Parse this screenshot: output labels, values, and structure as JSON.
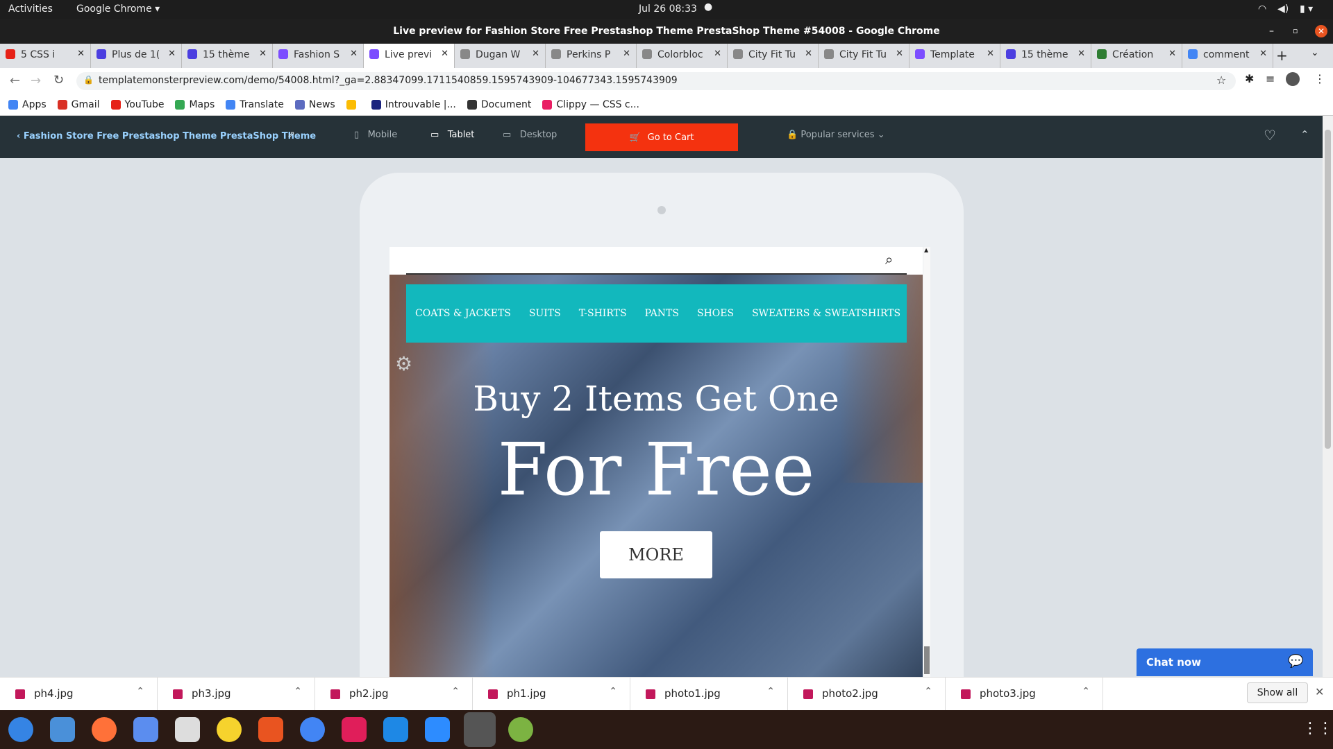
{
  "system_bar": {
    "activities": "Activities",
    "app_menu": "Google Chrome",
    "datetime": "Jul 26  08:33"
  },
  "window_title": "Live preview for Fashion Store Free Prestashop Theme PrestaShop Theme #54008 - Google Chrome",
  "tabs": [
    {
      "label": "5 CSS i",
      "color": "#e62117"
    },
    {
      "label": "Plus de 1(",
      "color": "#4b3ee0"
    },
    {
      "label": "15 thème",
      "color": "#4b3ee0"
    },
    {
      "label": "Fashion S",
      "color": "#7c4dff"
    },
    {
      "label": "Live previ",
      "color": "#7c4dff"
    },
    {
      "label": "Dugan W",
      "color": "#888888"
    },
    {
      "label": "Perkins P",
      "color": "#888888"
    },
    {
      "label": "Colorbloc",
      "color": "#888888"
    },
    {
      "label": "City Fit Tu",
      "color": "#888888"
    },
    {
      "label": "City Fit Tu",
      "color": "#888888"
    },
    {
      "label": "Template",
      "color": "#7c4dff"
    },
    {
      "label": "15 thème",
      "color": "#4b3ee0"
    },
    {
      "label": "Création",
      "color": "#2e7d32"
    },
    {
      "label": "comment",
      "color": "#4285f4"
    }
  ],
  "url": "templatemonsterpreview.com/demo/54008.html?_ga=2.88347099.1711540859.1595743909-104677343.1595743909",
  "bookmarks": [
    {
      "label": "Apps",
      "color": "#4285f4"
    },
    {
      "label": "Gmail",
      "color": "#d93025"
    },
    {
      "label": "YouTube",
      "color": "#e62117"
    },
    {
      "label": "Maps",
      "color": "#34a853"
    },
    {
      "label": "Translate",
      "color": "#4285f4"
    },
    {
      "label": "News",
      "color": "#5c6bc0"
    },
    {
      "label": "",
      "color": "#fbbc04"
    },
    {
      "label": "Introuvable |...",
      "color": "#1a237e"
    },
    {
      "label": "Document",
      "color": "#333333"
    },
    {
      "label": "Clippy — CSS c...",
      "color": "#e91e63"
    }
  ],
  "preview_bar": {
    "back_title": "Fashion Store Free Prestashop Theme PrestaShop Theme",
    "mobile": "Mobile",
    "tablet": "Tablet",
    "desktop": "Desktop",
    "cart": "Go to Cart",
    "services": "Popular services"
  },
  "site": {
    "menu": [
      "COATS & JACKETS",
      "SUITS",
      "T-SHIRTS",
      "PANTS",
      "SHOES",
      "SWEATERS & SWEATSHIRTS"
    ],
    "headline": "Buy 2 Items Get One",
    "headline_big": "For Free",
    "button": "MORE"
  },
  "chat": "Chat now",
  "downloads": [
    "ph4.jpg",
    "ph3.jpg",
    "ph2.jpg",
    "ph1.jpg",
    "photo1.jpg",
    "photo2.jpg",
    "photo3.jpg"
  ],
  "show_all": "Show all",
  "colors": {
    "accent_menu": "#12b8bd",
    "cart": "#f4320f",
    "chat": "#2d70e0"
  }
}
